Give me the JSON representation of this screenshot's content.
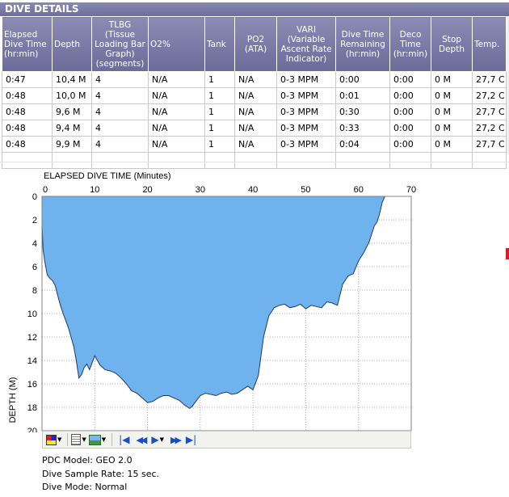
{
  "panel_title": "DIVE DETAILS",
  "table": {
    "columns": [
      "Elapsed Dive Time (hr:min)",
      "Depth",
      "TLBG (Tissue Loading Bar Graph) (segments)",
      "O2%",
      "Tank",
      "PO2 (ATA)",
      "VARI (Variable Ascent Rate Indicator)",
      "Dive Time Remaining (hr:min)",
      "Deco Time (hr:min)",
      "Stop Depth",
      "Temp."
    ],
    "rows": [
      [
        "0:47",
        "10,4 M",
        "4",
        "N/A",
        "1",
        "N/A",
        "0-3 MPM",
        "0:00",
        "0:00",
        "0 M",
        "27,7 C"
      ],
      [
        "0:48",
        "10,0 M",
        "4",
        "N/A",
        "1",
        "N/A",
        "0-3 MPM",
        "0:01",
        "0:00",
        "0 M",
        "27,2 C"
      ],
      [
        "0:48",
        "9,6 M",
        "4",
        "N/A",
        "1",
        "N/A",
        "0-3 MPM",
        "0:30",
        "0:00",
        "0 M",
        "27,7 C"
      ],
      [
        "0:48",
        "9,4 M",
        "4",
        "N/A",
        "1",
        "N/A",
        "0-3 MPM",
        "0:33",
        "0:00",
        "0 M",
        "27,2 C"
      ],
      [
        "0:48",
        "9,9 M",
        "4",
        "N/A",
        "1",
        "N/A",
        "0-3 MPM",
        "0:04",
        "0:00",
        "0 M",
        "27,7 C"
      ]
    ]
  },
  "chart_data": {
    "type": "area",
    "xlabel": "ELAPSED DIVE TIME (Minutes)",
    "ylabel": "DEPTH (M)",
    "xlim": [
      0,
      70
    ],
    "ylim": [
      0,
      20
    ],
    "x_ticks": [
      0,
      10,
      20,
      30,
      40,
      50,
      60,
      70
    ],
    "y_ticks": [
      0,
      2,
      4,
      6,
      8,
      10,
      12,
      14,
      16,
      18,
      20
    ],
    "y_inverted": true,
    "x_axis_position": "top",
    "grid": true,
    "fill_color": "#6fb3ee",
    "line_color": "#1c3b66",
    "x": [
      0,
      0.2,
      0.5,
      1,
      1.5,
      2,
      2.5,
      3,
      3.5,
      4,
      5,
      6,
      6.5,
      7,
      7.5,
      8,
      8.5,
      9,
      9.5,
      10,
      11,
      12,
      13,
      14,
      15,
      16,
      17,
      18,
      19,
      20,
      21,
      22,
      23,
      24,
      25,
      26,
      27,
      28,
      28.5,
      29,
      30,
      31,
      32,
      33,
      34,
      35,
      36,
      37,
      38,
      39,
      40,
      41,
      42,
      43,
      44,
      45,
      46,
      47,
      48,
      49,
      50,
      51,
      52,
      53,
      54,
      55,
      56,
      57,
      58,
      59,
      60,
      61,
      62,
      63,
      63.5,
      64,
      64.5,
      65
    ],
    "y": [
      2.5,
      4.5,
      5.5,
      6.7,
      7.0,
      7.2,
      7.6,
      8.5,
      9.3,
      10.0,
      11.2,
      12.8,
      14.0,
      15.5,
      15.2,
      14.6,
      14.3,
      14.8,
      14.2,
      13.6,
      14.4,
      14.8,
      14.9,
      15.1,
      15.5,
      16.0,
      16.6,
      16.8,
      17.2,
      17.6,
      17.5,
      17.2,
      17.0,
      17.0,
      17.2,
      17.4,
      17.8,
      18.1,
      17.9,
      17.6,
      17.0,
      16.8,
      16.9,
      17.0,
      16.8,
      16.7,
      16.9,
      16.8,
      16.5,
      16.2,
      16.5,
      15.3,
      12.0,
      10.2,
      9.5,
      9.3,
      9.2,
      9.5,
      9.4,
      9.2,
      9.6,
      9.3,
      9.4,
      9.5,
      9.0,
      9.1,
      9.3,
      7.5,
      6.8,
      6.6,
      5.5,
      4.8,
      3.9,
      2.5,
      2.2,
      1.5,
      0.5,
      0
    ]
  },
  "toolbar": {
    "icons": [
      "palette-icon",
      "report-icon",
      "image-icon",
      "first-icon",
      "rewind-icon",
      "play-icon",
      "fast-forward-icon",
      "last-icon"
    ]
  },
  "info": {
    "model": "PDC Model: GEO 2.0",
    "sample_rate": "Dive Sample Rate: 15 sec.",
    "mode": "Dive Mode: Normal"
  }
}
